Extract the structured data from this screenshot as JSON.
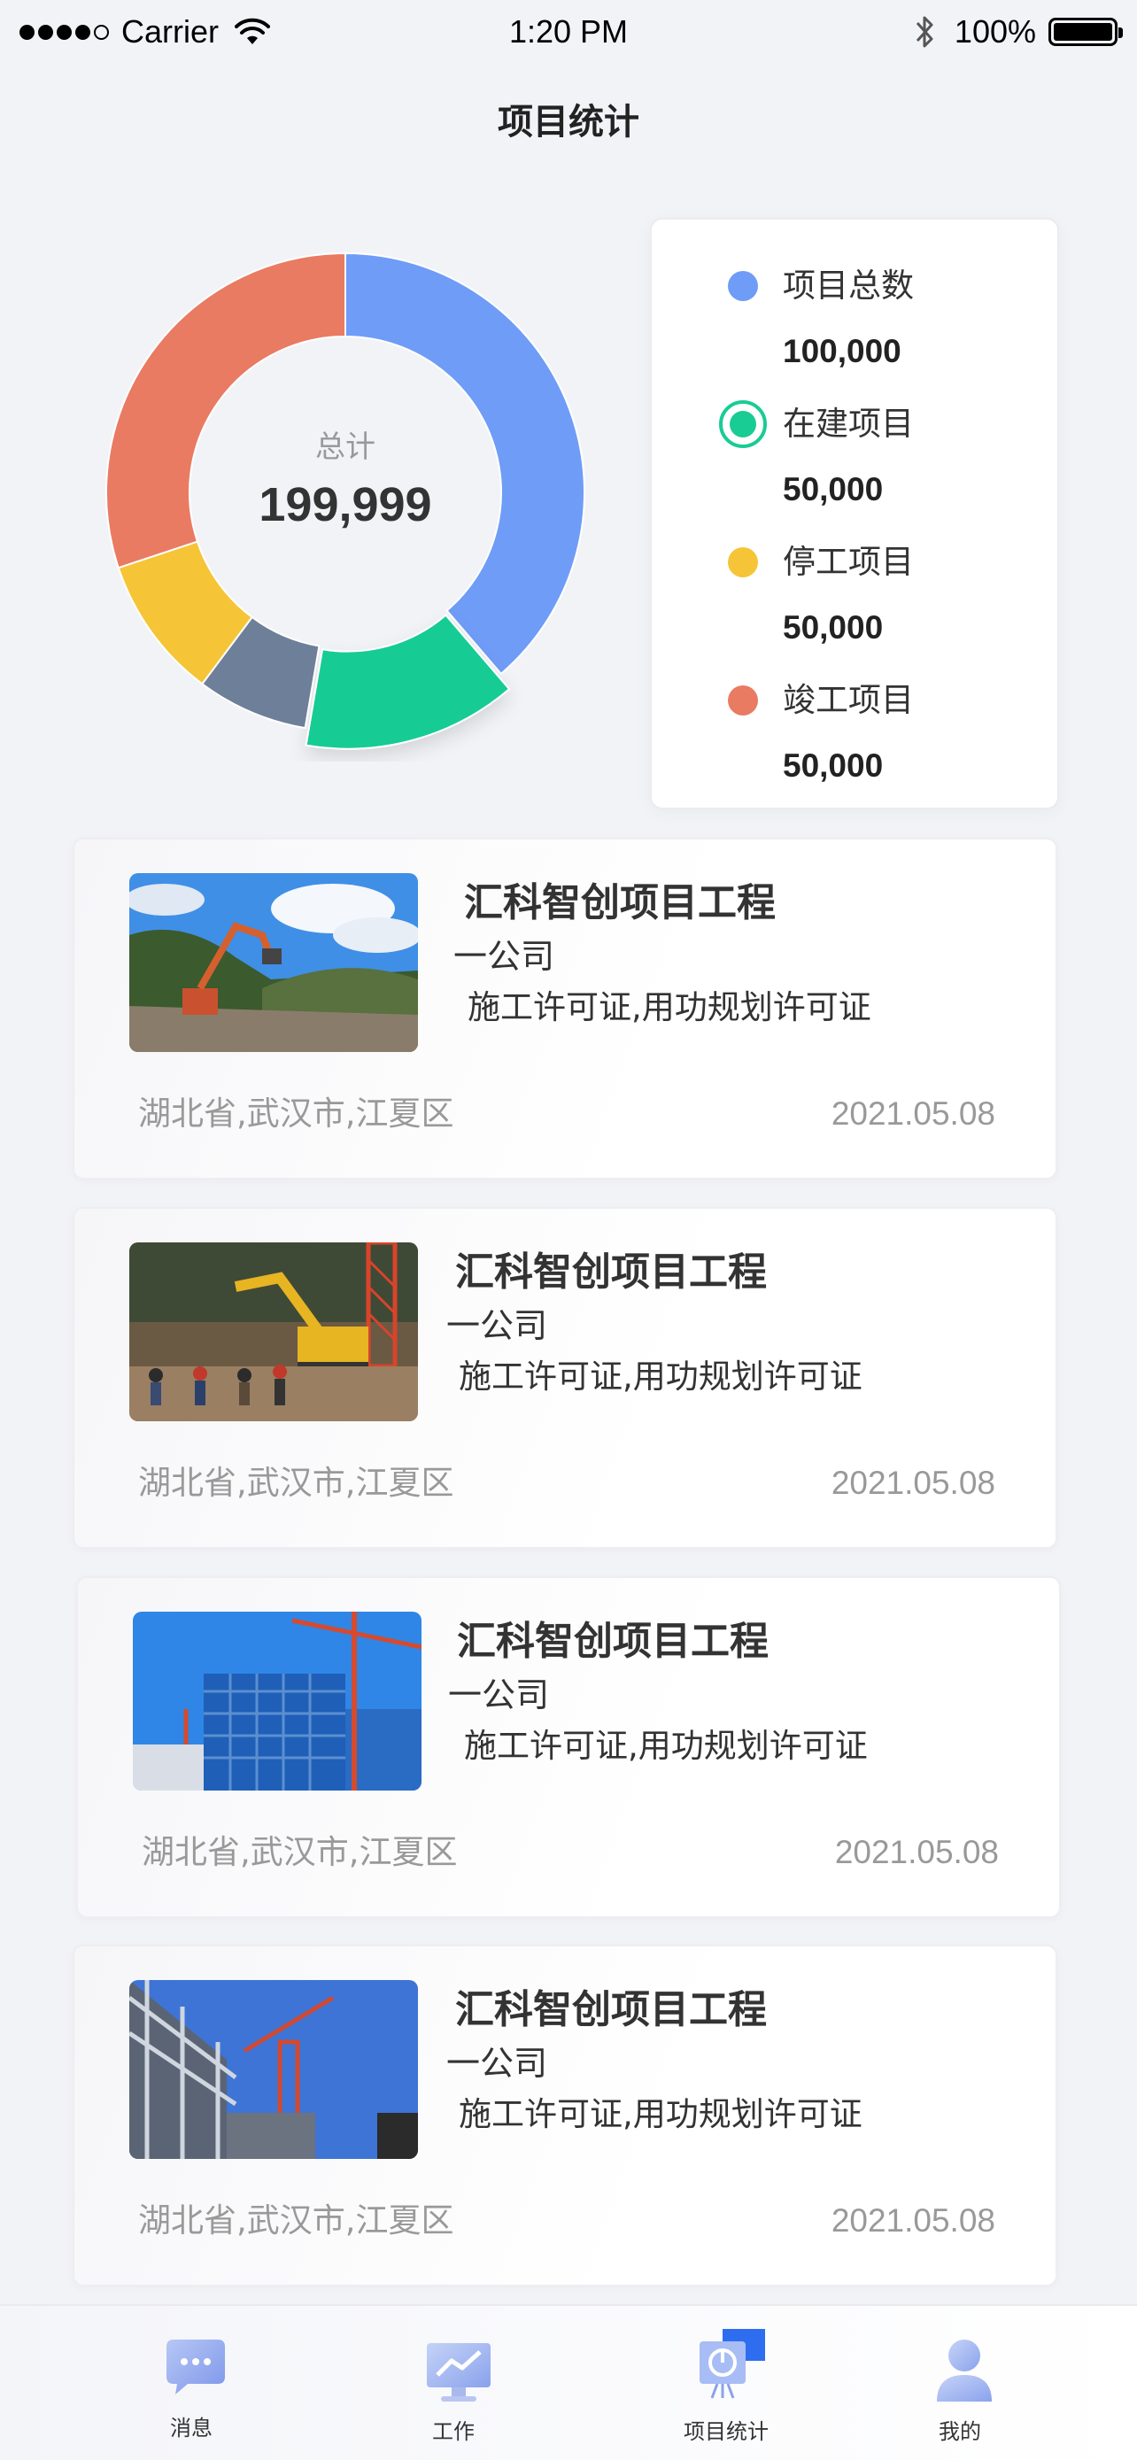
{
  "status_bar": {
    "carrier": "Carrier",
    "time": "1:20 PM",
    "battery": "100%"
  },
  "header": {
    "title": "项目统计"
  },
  "summary": {
    "total_label": "总计",
    "total_value": "199,999"
  },
  "legend": [
    {
      "label": "项目总数",
      "value": "100,000",
      "color": "#6f9cf7",
      "selected": false
    },
    {
      "label": "在建项目",
      "value": "50,000",
      "color": "#19cc94",
      "selected": true
    },
    {
      "label": "停工项目",
      "value": "50,000",
      "color": "#f5c537",
      "selected": false
    },
    {
      "label": "竣工项目",
      "value": "50,000",
      "color": "#e97b63",
      "selected": false
    }
  ],
  "chart_data": {
    "type": "pie",
    "categories": [
      "项目总数",
      "在建项目",
      "",
      "停工项目",
      "竣工项目"
    ],
    "values": [
      36,
      13,
      7,
      9,
      28
    ],
    "colors": [
      "#6f9cf7",
      "#19cc94",
      "#6e7f99",
      "#f5c537",
      "#e97b63"
    ],
    "center_label": "总计",
    "center_value": "199,999",
    "legend_position": "right"
  },
  "projects": [
    {
      "title": "汇科智创项目工程",
      "company": "一公司",
      "permits": "施工许可证,用功规划许可证",
      "location": "湖北省,武汉市,江夏区",
      "date": "2021.05.08",
      "image": "excavator-hillside-photo"
    },
    {
      "title": "汇科智创项目工程",
      "company": "一公司",
      "permits": "施工许可证,用功规划许可证",
      "location": "湖北省,武汉市,江夏区",
      "date": "2021.05.08",
      "image": "workers-excavator-photo"
    },
    {
      "title": "汇科智创项目工程",
      "company": "一公司",
      "permits": "施工许可证,用功规划许可证",
      "location": "湖北省,武汉市,江夏区",
      "date": "2021.05.08",
      "image": "building-crane-photo"
    },
    {
      "title": "汇科智创项目工程",
      "company": "一公司",
      "permits": "施工许可证,用功规划许可证",
      "location": "湖北省,武汉市,江夏区",
      "date": "2021.05.08",
      "image": "steel-frame-crane-photo"
    }
  ],
  "tabs": [
    {
      "label": "消息",
      "icon": "message-icon"
    },
    {
      "label": "工作",
      "icon": "work-chart-icon"
    },
    {
      "label": "项目统计",
      "icon": "project-stats-icon",
      "active": true
    },
    {
      "label": "我的",
      "icon": "profile-icon"
    }
  ]
}
